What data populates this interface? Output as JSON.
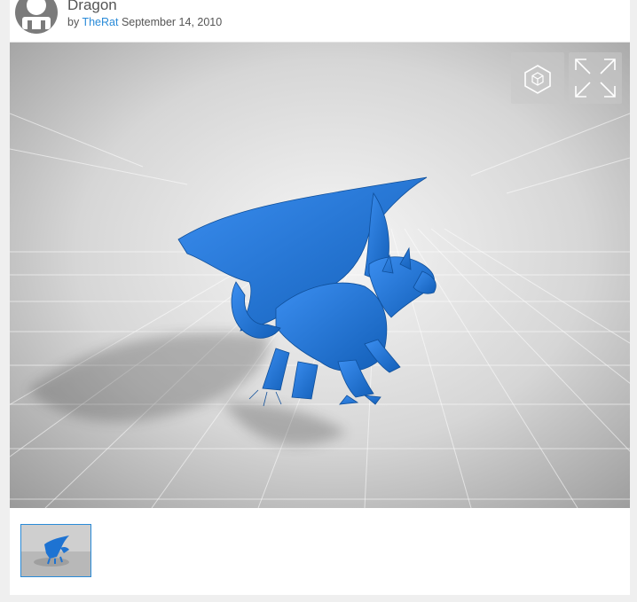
{
  "header": {
    "title": "Dragon",
    "by_prefix": "by",
    "author": "TheRat",
    "date": "September 14, 2010"
  },
  "viewer": {
    "model_color": "#1e73d2",
    "controls": [
      {
        "icon": "cube-icon"
      },
      {
        "icon": "fullscreen-icon"
      }
    ]
  },
  "thumbnails": [
    {
      "icon": "dragon-thumbnail",
      "selected": true
    }
  ]
}
